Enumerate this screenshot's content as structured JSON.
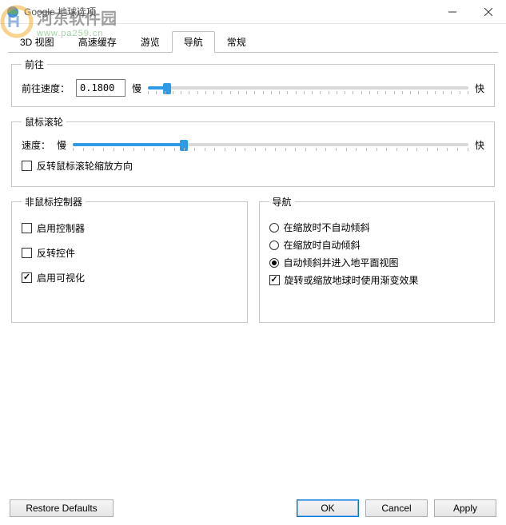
{
  "window": {
    "title": "Google 地球选项"
  },
  "watermark": {
    "line1": "河东软件园",
    "line2": "www.pa259.cn"
  },
  "tabs": {
    "t0": "3D 视图",
    "t1": "高速缓存",
    "t2": "游览",
    "t3": "导航",
    "t4": "常规"
  },
  "goto": {
    "legend": "前往",
    "speed_label": "前往速度：",
    "speed_value": "0.1800",
    "slow": "慢",
    "fast": "快",
    "percent": 6
  },
  "wheel": {
    "legend": "鼠标滚轮",
    "speed_label": "速度：",
    "slow": "慢",
    "fast": "快",
    "percent": 28,
    "invert_label": "反转鼠标滚轮缩放方向",
    "invert_checked": false
  },
  "controller": {
    "legend": "非鼠标控制器",
    "enable_label": "启用控制器",
    "enable_checked": false,
    "reverse_label": "反转控件",
    "reverse_checked": false,
    "viz_label": "启用可视化",
    "viz_checked": true
  },
  "nav": {
    "legend": "导航",
    "r0": "在缩放时不自动倾斜",
    "r1": "在缩放时自动倾斜",
    "r2": "自动倾斜并进入地平面视图",
    "selected": 2,
    "fade_label": "旋转或缩放地球时使用渐变效果",
    "fade_checked": true
  },
  "footer": {
    "restore": "Restore Defaults",
    "ok": "OK",
    "cancel": "Cancel",
    "apply": "Apply"
  }
}
